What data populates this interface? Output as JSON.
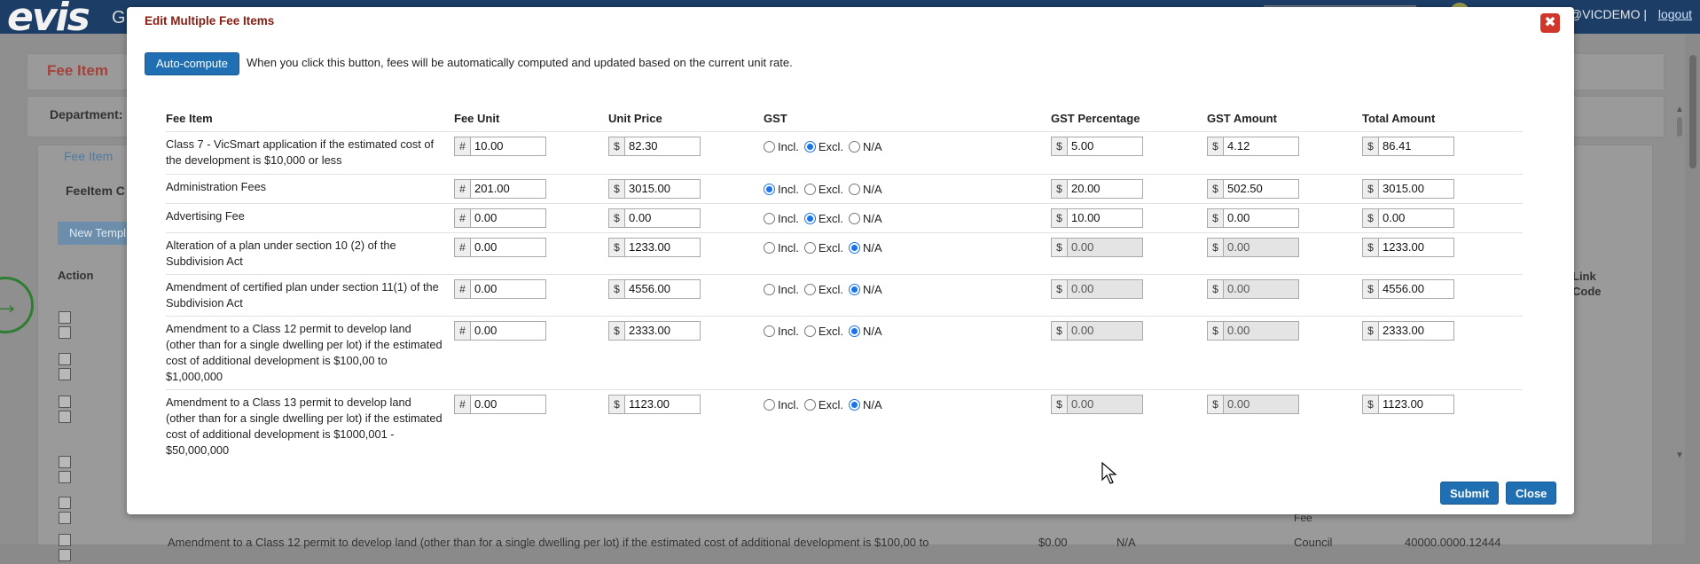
{
  "app": {
    "logo": "evis",
    "logo_suffix": "G",
    "user_text": "n@VICDEMO |",
    "logout": "logout"
  },
  "background": {
    "page_title": "Fee Item",
    "department_label": "Department:",
    "tab_fee_item": "Fee Item",
    "feeitem_c_label": "FeeItem C",
    "new_template_button": "New Templ",
    "action_header": "Action",
    "link_code_header": "Link Code",
    "fee_text": "Fee",
    "bottom_row_text": "Amendment to a Class 12 permit to develop land (other than for a single dwelling per lot) if the estimated cost of additional development is $100,00 to",
    "bottom_row_price": "$0.00",
    "bottom_row_gst": "N/A",
    "bottom_row_source": "Council",
    "bottom_row_code": "40000.0000.12444"
  },
  "modal": {
    "title": "Edit Multiple Fee Items",
    "auto_compute_label": "Auto-compute",
    "auto_compute_desc": "When you click this button, fees will be automatically computed and updated based on the current unit rate.",
    "submit_label": "Submit",
    "close_label": "Close",
    "columns": {
      "fee_item": "Fee Item",
      "fee_unit": "Fee Unit",
      "unit_price": "Unit Price",
      "gst": "GST",
      "gst_percentage": "GST Percentage",
      "gst_amount": "GST Amount",
      "total_amount": "Total Amount"
    },
    "prefix_unit": "#",
    "prefix_money": "$",
    "gst_options": {
      "incl": "Incl.",
      "excl": "Excl.",
      "na": "N/A"
    },
    "rows": [
      {
        "name": "Class 7 - VicSmart application if the estimated cost of the development is $10,000 or less",
        "fee_unit": "10.00",
        "unit_price": "82.30",
        "gst": "excl",
        "gst_percentage": "5.00",
        "gst_amount": "4.12",
        "total_amount": "86.41"
      },
      {
        "name": "Administration Fees",
        "fee_unit": "201.00",
        "unit_price": "3015.00",
        "gst": "incl",
        "gst_percentage": "20.00",
        "gst_amount": "502.50",
        "total_amount": "3015.00"
      },
      {
        "name": "Advertising Fee",
        "fee_unit": "0.00",
        "unit_price": "0.00",
        "gst": "excl",
        "gst_percentage": "10.00",
        "gst_amount": "0.00",
        "total_amount": "0.00"
      },
      {
        "name": "Alteration of a plan under section 10 (2) of the Subdivision Act",
        "fee_unit": "0.00",
        "unit_price": "1233.00",
        "gst": "na",
        "gst_percentage": "0.00",
        "gst_amount": "0.00",
        "total_amount": "1233.00"
      },
      {
        "name": "Amendment of certified plan under section 11(1) of the Subdivision Act",
        "fee_unit": "0.00",
        "unit_price": "4556.00",
        "gst": "na",
        "gst_percentage": "0.00",
        "gst_amount": "0.00",
        "total_amount": "4556.00"
      },
      {
        "name": "Amendment to a Class 12 permit to develop land (other than for a single dwelling per lot) if the estimated cost of additional development is $100,00 to $1,000,000",
        "fee_unit": "0.00",
        "unit_price": "2333.00",
        "gst": "na",
        "gst_percentage": "0.00",
        "gst_amount": "0.00",
        "total_amount": "2333.00"
      },
      {
        "name": "Amendment to a Class 13 permit to develop land (other than for a single dwelling per lot) if the estimated cost of additional development is $1000,001 - $50,000,000",
        "fee_unit": "0.00",
        "unit_price": "1123.00",
        "gst": "na",
        "gst_percentage": "0.00",
        "gst_amount": "0.00",
        "total_amount": "1123.00"
      }
    ]
  }
}
